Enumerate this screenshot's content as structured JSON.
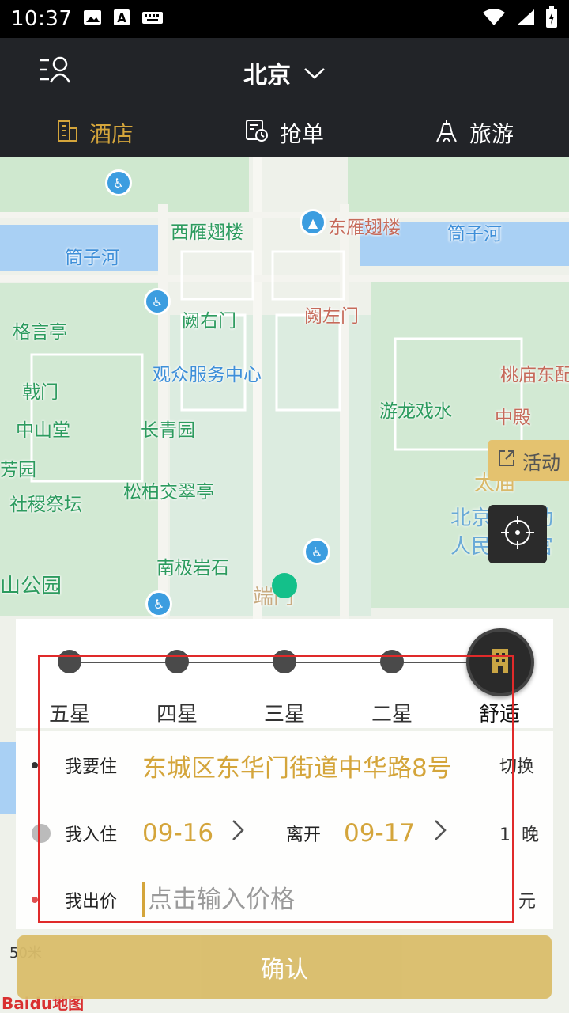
{
  "status": {
    "time": "10:37"
  },
  "header": {
    "city": "北京"
  },
  "tabs": [
    {
      "label": "酒店"
    },
    {
      "label": "抢单"
    },
    {
      "label": "旅游"
    }
  ],
  "map": {
    "labels": [
      {
        "text": "西雁翅楼"
      },
      {
        "text": "东雁翅楼"
      },
      {
        "text": "筒子河"
      },
      {
        "text": "筒子河"
      },
      {
        "text": "阙右门"
      },
      {
        "text": "阙左门"
      },
      {
        "text": "格言亭"
      },
      {
        "text": "观众服务中心"
      },
      {
        "text": "戟门"
      },
      {
        "text": "桃庙东配"
      },
      {
        "text": "游龙戏水"
      },
      {
        "text": "中殿"
      },
      {
        "text": "中山堂"
      },
      {
        "text": "长青园"
      },
      {
        "text": "芳园"
      },
      {
        "text": "松柏交翠亭"
      },
      {
        "text": "社稷祭坛"
      },
      {
        "text": "北京市劳动"
      },
      {
        "text": "人民文化宫"
      },
      {
        "text": "南极岩石"
      },
      {
        "text": "山公园"
      },
      {
        "text": "端门"
      },
      {
        "text": "太庙"
      }
    ],
    "activity_label": "活动",
    "scale": "50米",
    "provider": "Baidu地图"
  },
  "star_levels": [
    "五星",
    "四星",
    "三星",
    "二星",
    "舒适"
  ],
  "form": {
    "stay_label": "我要住",
    "address": "东城区东华门街道中华路8号",
    "switch_label": "切换",
    "checkin_label": "我入住",
    "checkin_date": "09-16",
    "checkout_label": "离开",
    "checkout_date": "09-17",
    "nights_count": "1",
    "nights_unit": "晚",
    "price_label": "我出价",
    "price_placeholder": "点击输入价格",
    "price_unit": "元"
  },
  "confirm_label": "确认"
}
